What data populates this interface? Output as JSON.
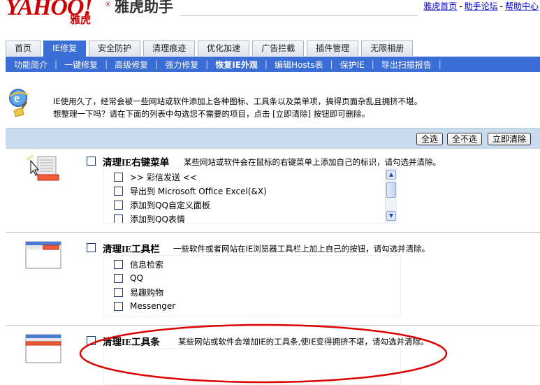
{
  "header": {
    "logo_text": "YAHOO!",
    "logo_reg": "®",
    "logo_sub": "雅虎",
    "app_title": "雅虎助手",
    "links": [
      {
        "label": "雅虎首页"
      },
      {
        "label": "助手论坛"
      },
      {
        "label": "帮助中心"
      }
    ],
    "link_separator": "-"
  },
  "tabs": [
    {
      "label": "首页",
      "active": false
    },
    {
      "label": "IE修复",
      "active": true
    },
    {
      "label": "安全防护",
      "active": false
    },
    {
      "label": "清理痕迹",
      "active": false
    },
    {
      "label": "优化加速",
      "active": false
    },
    {
      "label": "广告拦截",
      "active": false
    },
    {
      "label": "插件管理",
      "active": false
    },
    {
      "label": "无限相册",
      "active": false
    }
  ],
  "subnav": {
    "separator": "|",
    "items": [
      {
        "label": "功能简介",
        "selected": false
      },
      {
        "label": "一键修复",
        "selected": false
      },
      {
        "label": "高级修复",
        "selected": false
      },
      {
        "label": "强力修复",
        "selected": false
      },
      {
        "label": "恢复IE外观",
        "selected": true
      },
      {
        "label": "编辑Hosts表",
        "selected": false
      },
      {
        "label": "保护IE",
        "selected": false
      },
      {
        "label": "导出扫描报告",
        "selected": false
      }
    ]
  },
  "intro": {
    "line1": "IE使用久了，经常会被一些网站或软件添加上各种图标、工具条以及菜单项，搞得页面杂乱且拥挤不堪。",
    "line2": "想整理一下吗？请在下面的列表中勾选您不需要的项目，点击 [立即清除] 按钮即可删除。"
  },
  "actions": {
    "select_all": "全选",
    "select_none": "全不选",
    "clear_now": "立即清除"
  },
  "sections": [
    {
      "title": "清理IE右键菜单",
      "desc": "某些网站或软件会在鼠标的右键菜单上添加自己的标识，请勾选并清除。",
      "items": [
        ">> 彩信发送 <<",
        "导出到 Microsoft Office Excel(&X)",
        "添加到QQ自定义面板",
        "添加到QQ表情"
      ]
    },
    {
      "title": "清理IE工具栏",
      "desc": "一些软件或者网站在IE浏览器工具栏上加上自己的按钮，请勾选并清除。",
      "items": [
        "信息检索",
        "QQ",
        "易趣购物",
        "Messenger"
      ]
    },
    {
      "title": "清理IE工具条",
      "desc": "某些网站或软件会增加IE的工具条,使IE变得拥挤不堪，请勾选并清除。",
      "items": []
    }
  ],
  "colors": {
    "accent": "#3a6dd5",
    "brand": "#cc0000",
    "action_bar": "#c9dcee",
    "annotation": "#dd0000"
  }
}
